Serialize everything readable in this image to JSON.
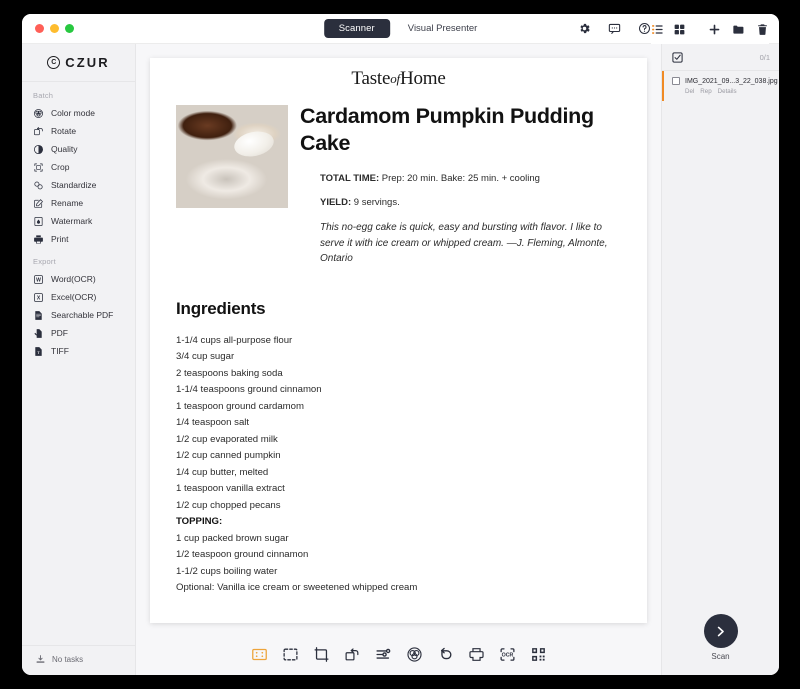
{
  "titlebar": {
    "mode_active": "Scanner",
    "mode_inactive": "Visual Presenter",
    "icons": [
      "gear-icon",
      "chat-icon",
      "help-icon"
    ]
  },
  "panel_toolbar": {
    "list_view": "list-view-icon",
    "grid_view": "grid-view-icon",
    "add": "add-icon",
    "folder": "folder-icon",
    "delete": "trash-icon"
  },
  "sidebar": {
    "brand": "CZUR",
    "sections": [
      {
        "label": "Batch",
        "items": [
          {
            "label": "Color mode",
            "icon": "color-mode-icon"
          },
          {
            "label": "Rotate",
            "icon": "rotate-icon"
          },
          {
            "label": "Quality",
            "icon": "quality-icon"
          },
          {
            "label": "Crop",
            "icon": "crop-icon"
          },
          {
            "label": "Standardize",
            "icon": "standardize-icon"
          },
          {
            "label": "Rename",
            "icon": "rename-icon"
          },
          {
            "label": "Watermark",
            "icon": "watermark-icon"
          },
          {
            "label": "Print",
            "icon": "print-icon"
          }
        ]
      },
      {
        "label": "Export",
        "items": [
          {
            "label": "Word(OCR)",
            "icon": "word-icon"
          },
          {
            "label": "Excel(OCR)",
            "icon": "excel-icon"
          },
          {
            "label": "Searchable PDF",
            "icon": "searchable-pdf-icon"
          },
          {
            "label": "PDF",
            "icon": "pdf-icon"
          },
          {
            "label": "TIFF",
            "icon": "tiff-icon"
          }
        ]
      }
    ],
    "footer_status": "No tasks"
  },
  "document": {
    "brand_logo_part1": "Taste",
    "brand_logo_of": "of",
    "brand_logo_part2": "Home",
    "title": "Cardamom Pumpkin Pudding Cake",
    "total_time_label": "TOTAL TIME:",
    "total_time_value": "Prep: 20 min. Bake: 25 min. + cooling",
    "yield_label": "YIELD:",
    "yield_value": "9 servings.",
    "blurb": "This no-egg cake is quick, easy and bursting with flavor. I like to serve it with ice cream or whipped cream. —J. Fleming, Almonte, Ontario",
    "ingredients_heading": "Ingredients",
    "ingredients": [
      {
        "text": "1-1/4 cups all-purpose flour",
        "heading": false
      },
      {
        "text": "3/4 cup sugar",
        "heading": false
      },
      {
        "text": "2 teaspoons baking soda",
        "heading": false
      },
      {
        "text": "1-1/4 teaspoons ground cinnamon",
        "heading": false
      },
      {
        "text": "1 teaspoon ground cardamom",
        "heading": false
      },
      {
        "text": "1/4 teaspoon salt",
        "heading": false
      },
      {
        "text": "1/2 cup evaporated milk",
        "heading": false
      },
      {
        "text": "1/2 cup canned pumpkin",
        "heading": false
      },
      {
        "text": "1/4 cup butter, melted",
        "heading": false
      },
      {
        "text": "1 teaspoon vanilla extract",
        "heading": false
      },
      {
        "text": "1/2 cup chopped pecans",
        "heading": false
      },
      {
        "text": "TOPPING:",
        "heading": true
      },
      {
        "text": "1 cup packed brown sugar",
        "heading": false
      },
      {
        "text": "1/2 teaspoon ground cinnamon",
        "heading": false
      },
      {
        "text": "1-1/2 cups boiling water",
        "heading": false
      },
      {
        "text": "Optional: Vanilla ice cream or sweetened whipped cream",
        "heading": false
      }
    ]
  },
  "bottom_toolbar": {
    "buttons": [
      {
        "name": "dewarp-icon",
        "active": true
      },
      {
        "name": "select-area-icon",
        "active": false
      },
      {
        "name": "crop-icon",
        "active": false
      },
      {
        "name": "rotate-icon",
        "active": false
      },
      {
        "name": "adjust-icon",
        "active": false
      },
      {
        "name": "color-mode-icon",
        "active": false
      },
      {
        "name": "undo-icon",
        "active": false
      },
      {
        "name": "print-icon",
        "active": false
      },
      {
        "name": "ocr-icon",
        "active": false
      },
      {
        "name": "qrcode-icon",
        "active": false
      }
    ]
  },
  "file_panel": {
    "selection_count": "0/1",
    "files": [
      {
        "name": "IMG_2021_09...3_22_038.jpg",
        "actions": [
          "Del",
          "Rep",
          "Details"
        ]
      }
    ],
    "scan_label": "Scan"
  },
  "colors": {
    "accent_orange": "#f08a24",
    "dark_navy": "#2b2f3d",
    "sidebar_bg": "#f2f2f4",
    "canvas_bg": "#f7f7f9"
  }
}
